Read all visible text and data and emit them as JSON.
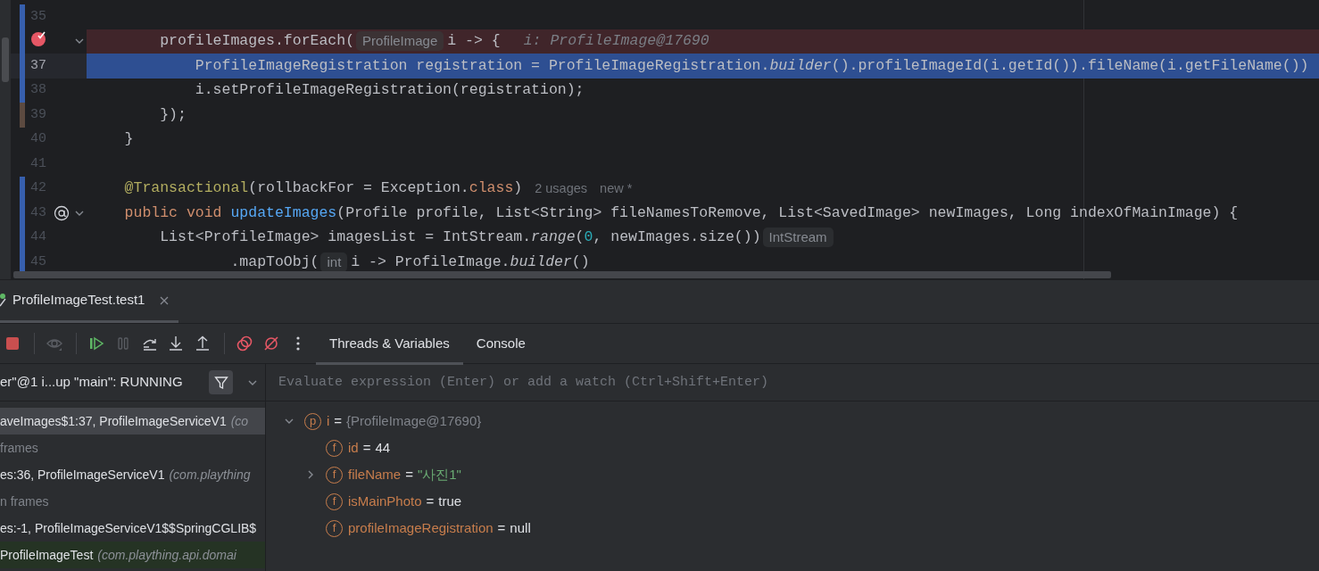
{
  "editor": {
    "lines": [
      {
        "number": "35",
        "color": "#375fad"
      },
      {
        "color": "#375fad",
        "breakpoint": true,
        "fold": true,
        "tokens": [
          {
            "kind": "plain",
            "text": "        profileImages.forEach("
          },
          {
            "kind": "hint",
            "text": "ProfileImage"
          },
          {
            "kind": "plain",
            "text": "i -> {"
          },
          {
            "kind": "value",
            "text": "i: ProfileImage@17690"
          }
        ]
      },
      {
        "number": "37",
        "color": "#375fad",
        "execution_point": true,
        "tokens": [
          {
            "kind": "plain",
            "text": "            ProfileImageRegistration registration = ProfileImageRegistration."
          },
          {
            "kind": "italic",
            "text": "builder"
          },
          {
            "kind": "plain",
            "text": "().profileImageId(i.getId()).fileName(i.getFileName())"
          }
        ]
      },
      {
        "number": "38",
        "color": "#375fad",
        "tokens": [
          {
            "kind": "plain",
            "text": "            i.setProfileImageRegistration(registration);"
          }
        ]
      },
      {
        "number": "39",
        "color": "#5c4a40",
        "tokens": [
          {
            "kind": "plain",
            "text": "        });"
          }
        ]
      },
      {
        "number": "40",
        "tokens": [
          {
            "kind": "plain",
            "text": "    }"
          }
        ]
      },
      {
        "number": "41"
      },
      {
        "number": "42",
        "color": "#375fad",
        "tokens": [
          {
            "kind": "annotation",
            "text": "    @Transactional"
          },
          {
            "kind": "plain",
            "text": "(rollbackFor = Exception."
          },
          {
            "kind": "keyword",
            "text": "class"
          },
          {
            "kind": "plain",
            "text": ")"
          },
          {
            "kind": "meta",
            "text": "2 usages"
          },
          {
            "kind": "meta",
            "text": "new *"
          }
        ]
      },
      {
        "number": "43",
        "color": "#375fad",
        "annotated": true,
        "fold": true,
        "tokens": [
          {
            "kind": "keyword",
            "text": "    public void "
          },
          {
            "kind": "function",
            "text": "updateImages"
          },
          {
            "kind": "plain",
            "text": "(Profile profile, List<String> fileNamesToRemove, List<SavedImage> newImages, Long indexOfMainImage) {"
          }
        ]
      },
      {
        "number": "44",
        "color": "#375fad",
        "tokens": [
          {
            "kind": "plain",
            "text": "        List<ProfileImage> imagesList = IntStream."
          },
          {
            "kind": "italic",
            "text": "range"
          },
          {
            "kind": "plain",
            "text": "("
          },
          {
            "kind": "number",
            "text": "0"
          },
          {
            "kind": "plain",
            "text": ", newImages.size())"
          },
          {
            "kind": "hint",
            "text": "IntStream"
          }
        ]
      },
      {
        "number": "45",
        "color": "#375fad",
        "tokens": [
          {
            "kind": "plain",
            "text": "                .mapToObj("
          },
          {
            "kind": "hint",
            "text": "int"
          },
          {
            "kind": "plain",
            "text": "i -> ProfileImage."
          },
          {
            "kind": "italic",
            "text": "builder"
          },
          {
            "kind": "plain",
            "text": "()"
          }
        ]
      }
    ]
  },
  "session_tabs": [
    {
      "label": "ProfileImageTest.test1",
      "selected": true
    }
  ],
  "toolbar": [
    {
      "kind": "stop",
      "disabled": false
    },
    {
      "kind": "separator"
    },
    {
      "kind": "watch",
      "disabled": true
    },
    {
      "kind": "separator"
    },
    {
      "kind": "resume",
      "disabled": false
    },
    {
      "kind": "pause",
      "disabled": true
    },
    {
      "kind": "step_over",
      "disabled": false
    },
    {
      "kind": "step_into",
      "disabled": false
    },
    {
      "kind": "step_out",
      "disabled": false
    },
    {
      "kind": "separator"
    },
    {
      "kind": "breakpoints",
      "disabled": false
    },
    {
      "kind": "mute",
      "disabled": false
    },
    {
      "kind": "more",
      "disabled": false
    }
  ],
  "debug_tabs": [
    {
      "label": "Threads & Variables",
      "selected": true
    },
    {
      "label": "Console",
      "selected": false
    }
  ],
  "thread_selector": {
    "text": "er\"@1 i...up \"main\": RUNNING"
  },
  "evaluate_field": {
    "placeholder": "Evaluate expression (Enter) or add a watch (Ctrl+Shift+Enter)"
  },
  "frames": [
    {
      "kind": "frame",
      "selected": true,
      "location": "aveImages$1:37, ProfileImageServiceV1",
      "package": "(co"
    },
    {
      "kind": "group",
      "selected": false,
      "location": "frames"
    },
    {
      "kind": "frame",
      "selected": false,
      "location": "es:36, ProfileImageServiceV1",
      "package": "(com.plaything"
    },
    {
      "kind": "group",
      "selected": false,
      "location": "n frames"
    },
    {
      "kind": "frame",
      "selected": false,
      "location": "es:-1, ProfileImageServiceV1$$SpringCGLIB$"
    },
    {
      "kind": "test",
      "selected": false,
      "location": "ProfileImageTest",
      "package": "(com.plaything.api.domai"
    }
  ],
  "variables": [
    {
      "badge": "p",
      "name": "i",
      "operator": "=",
      "value": "{ProfileImage@17690}",
      "kind": "object",
      "expanded": true,
      "children": [
        {
          "badge": "f",
          "name": "id",
          "operator": "=",
          "value": "44",
          "kind": "number"
        },
        {
          "badge": "f",
          "name": "fileName",
          "operator": "=",
          "value": "\"사진1\"",
          "kind": "string",
          "expanded": false
        },
        {
          "badge": "f",
          "name": "isMainPhoto",
          "operator": "=",
          "value": "true",
          "kind": "keyword"
        },
        {
          "badge": "f",
          "name": "profileImageRegistration",
          "operator": "=",
          "value": "null",
          "kind": "keyword"
        }
      ]
    }
  ]
}
